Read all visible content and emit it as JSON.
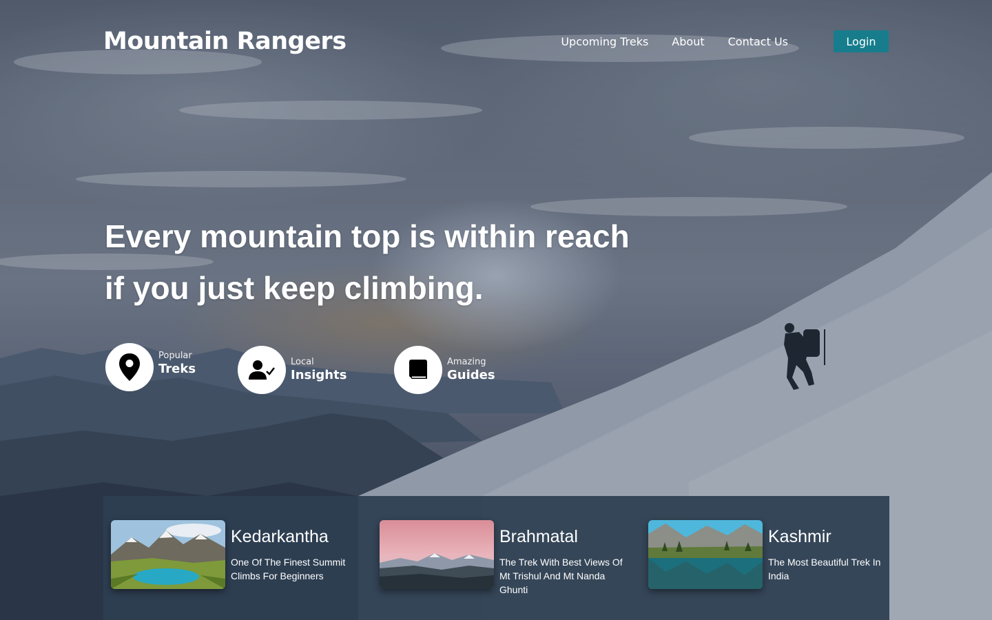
{
  "header": {
    "logo": "Mountain Rangers",
    "nav": [
      "Upcoming Treks",
      "About",
      "Contact Us"
    ],
    "login_label": "Login"
  },
  "hero": {
    "line1": "Every mountain top is within reach",
    "line2": "if you just keep climbing."
  },
  "features": [
    {
      "small": "Popular",
      "big": "Treks",
      "icon": "map-pin-icon"
    },
    {
      "small": "Local",
      "big": "Insights",
      "icon": "user-check-icon"
    },
    {
      "small": "Amazing",
      "big": "Guides",
      "icon": "book-icon"
    }
  ],
  "treks": [
    {
      "title": "Kedarkantha",
      "desc": "One Of The Finest Summit Climbs For Beginners",
      "image": "alpine-lake-valley-image"
    },
    {
      "title": "Brahmatal",
      "desc": "The Trek With Best Views Of Mt Trishul And Mt Nanda Ghunti",
      "image": "pink-sky-mountain-image"
    },
    {
      "title": "Kashmir",
      "desc": "The Most Beautiful Trek In India",
      "image": "mountain-lake-reflection-image"
    }
  ],
  "colors": {
    "accent": "#177d8c",
    "panel": "#2d3e52",
    "text": "#ffffff"
  }
}
